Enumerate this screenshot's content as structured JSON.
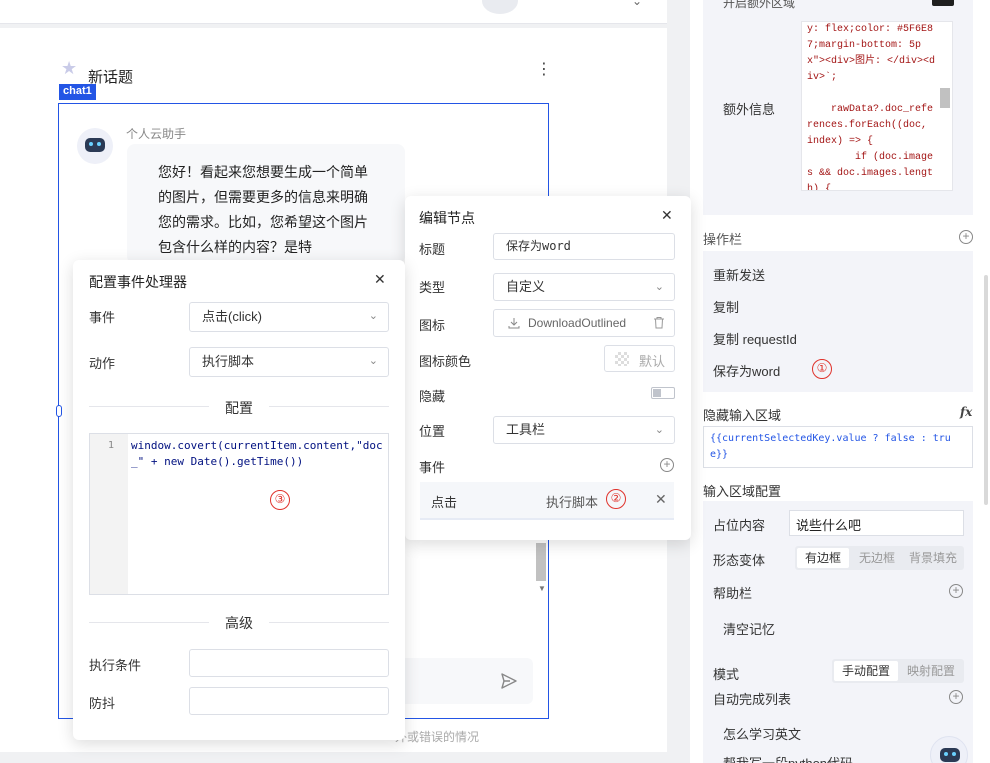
{
  "canvas": {
    "topic_title": "新话题",
    "chat_tag": "chat1",
    "bot_name": "个人云助手",
    "bot_message": "您好！看起来您想要生成一个简单的图片，但需要更多的信息来明确您的需求。比如，您希望这个图片包含什么样的内容？是特",
    "footer_text": "外或错误的情况"
  },
  "edit_node": {
    "title": "编辑节点",
    "label_title": "标题",
    "title_value": "保存为word",
    "label_type": "类型",
    "type_value": "自定义",
    "label_icon": "图标",
    "icon_value": "DownloadOutlined",
    "label_icon_color": "图标颜色",
    "icon_color_value": "默认",
    "label_hidden": "隐藏",
    "label_position": "位置",
    "position_value": "工具栏",
    "label_events": "事件",
    "event_name": "点击",
    "event_action": "执行脚本",
    "annotation": "②"
  },
  "config_event": {
    "title": "配置事件处理器",
    "label_event": "事件",
    "event_value": "点击(click)",
    "label_action": "动作",
    "action_value": "执行脚本",
    "section_config": "配置",
    "line_number": "1",
    "script_code": "window.covert(currentItem.content,\"doc_\" + new Date().getTime())",
    "annotation": "③",
    "section_advanced": "高级",
    "label_condition": "执行条件",
    "label_debounce": "防抖"
  },
  "right_panel": {
    "extra_area_label": "开启额外区域",
    "extra_info_label": "额外信息",
    "extra_info_code": "y: flex;color: #5F6E87;margin-bottom: 5px\"><div>图片: </div><div>`;\n\n    rawData?.doc_references.forEach((doc, index) => {\n        if (doc.images && doc.images.length) {",
    "toolbar_label": "操作栏",
    "toolbar_items": [
      "重新发送",
      "复制",
      "复制 requestId",
      "保存为word"
    ],
    "annotation": "①",
    "hidden_input_label": "隐藏输入区域",
    "fx_label": "fx",
    "hidden_input_expr": "{{currentSelectedKey.value ? false : true}}",
    "input_config_label": "输入区域配置",
    "placeholder_label": "占位内容",
    "placeholder_value": "说些什么吧",
    "variant_label": "形态变体",
    "variants": [
      "有边框",
      "无边框",
      "背景填充"
    ],
    "help_label": "帮助栏",
    "clear_memory": "清空记忆",
    "mode_label": "模式",
    "modes": [
      "手动配置",
      "映射配置"
    ],
    "autocomplete_label": "自动完成列表",
    "autocomplete_items": [
      "怎么学习英文",
      "帮我写一段python代码"
    ]
  },
  "colors": {
    "accent": "#2355e5",
    "annotation_red": "#e0322b",
    "panel_bg": "#f3f4f9"
  }
}
